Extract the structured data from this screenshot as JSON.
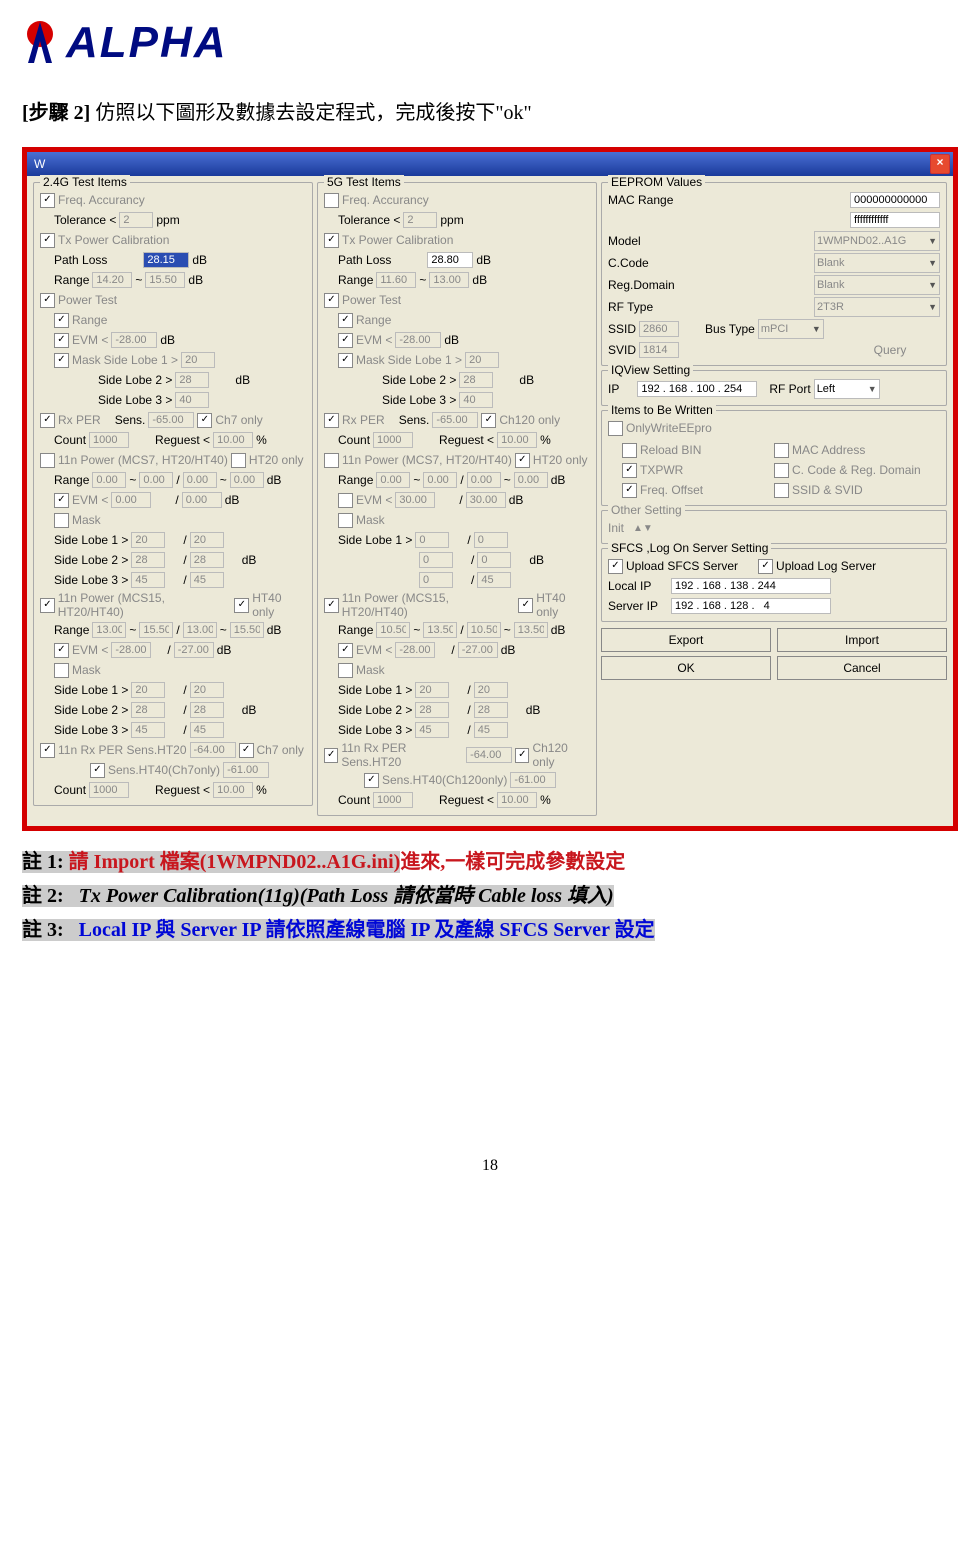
{
  "document": {
    "logo": "ALPHA",
    "step_label": "[步驟 2]",
    "step_text": "仿照以下圖形及數據去設定程式，完成後按下\"ok\"",
    "notes": {
      "n1_label": "註 1:",
      "n1_a": "請 Import 檔案(1WMPND02..A1G.ini)",
      "n1_b": "進來,一樣可完成參數設定",
      "n2_label": "註 2:",
      "n2_text": "Tx Power Calibration(11g)(Path Loss 請依當時 Cable loss 填入)",
      "n3_label": "註 3:",
      "n3_text": "Local IP 與 Server IP 請依照產線電腦 IP 及產線 SFCS Server 設定"
    },
    "page_number": "18"
  },
  "window": {
    "title": "W",
    "groups": {
      "g24": "2.4G Test Items",
      "g5": "5G Test Items",
      "eeprom": "EEPROM Values",
      "iq": "IQView Setting",
      "items": "Items to Be Written",
      "other": "Other Setting",
      "sfcs": "SFCS ,Log On Server Setting"
    },
    "labels": {
      "freq": "Freq. Accurancy",
      "tol": "Tolerance <",
      "ppm": "ppm",
      "txcal": "Tx Power Calibration",
      "path": "Path Loss",
      "range": "Range",
      "db": "dB",
      "ptest": "Power Test",
      "evm": "EVM <",
      "mask": "Mask",
      "sl1": "Side Lobe 1 >",
      "sl2": "Side Lobe 2 >",
      "sl3": "Side Lobe 3 >",
      "rxper": "Rx PER",
      "sens": "Sens.",
      "ch7": "Ch7 only",
      "ch120": "Ch120 only",
      "count": "Count",
      "reguest": "Reguest <",
      "pct": "%",
      "mcs7": "11n Power (MCS7, HT20/HT40)",
      "mcs15": "11n Power (MCS15, HT20/HT40)",
      "ht20": "HT20 only",
      "ht40": "HT40 only",
      "rxper11n": "11n Rx PER  Sens.HT20",
      "sensht40_7": "Sens.HT40(Ch7only)",
      "sensht40_120": "Sens.HT40(Ch120only)",
      "mac": "MAC Range",
      "model": "Model",
      "ccode": "C.Code",
      "reg": "Reg.Domain",
      "rf": "RF Type",
      "ssid": "SSID",
      "svid": "SVID",
      "bus": "Bus Type",
      "query": "Query",
      "ip": "IP",
      "rfport": "RF Port",
      "only": "OnlyWriteEEpro",
      "reload": "Reload BIN",
      "txpwr": "TXPWR",
      "freqoff": "Freq. Offset",
      "macaddr": "MAC Address",
      "ccreg": "C. Code & Reg. Domain",
      "ssidsvid": "SSID & SVID",
      "init": "Init",
      "upsfcs": "Upload SFCS Server",
      "uplog": "Upload Log Server",
      "localip": "Local IP",
      "serverip": "Server IP",
      "export": "Export",
      "import": "Import",
      "ok": "OK",
      "cancel": "Cancel",
      "slash": "/",
      "tilde": "~"
    },
    "values": {
      "tol24": "2",
      "tol5": "2",
      "path24": "28.15",
      "path5": "28.80",
      "range24a": "14.20",
      "range24b": "15.50",
      "range5a": "11.60",
      "range5b": "13.00",
      "evm24": "-28.00",
      "evm5": "-28.00",
      "sl_20": "20",
      "sl_28": "28",
      "sl_40": "40",
      "sl_45": "45",
      "sl_0": "0",
      "sens24": "-65.00",
      "sens5": "-65.00",
      "count": "1000",
      "reg10": "10.00",
      "mcs7_r": "0.00",
      "evm7_30": "30.00",
      "mcs15_a": "13.00",
      "mcs15_b": "15.50",
      "mcs15_5a": "10.50",
      "mcs15_5b": "13.50",
      "evm15a": "-28.00",
      "evm15b": "-27.00",
      "ht20sens": "-64.00",
      "ht40sens": "-61.00",
      "mac1": "000000000000",
      "mac2": "ffffffffffff",
      "model": "1WMPND02..A1G",
      "blank": "Blank",
      "rf": "2T3R",
      "ssid": "2860",
      "svid": "1814",
      "bus": "mPCI",
      "ip": "192 . 168 . 100 . 254",
      "rfport": "Left",
      "localip": "192 . 168 . 138 . 244",
      "serverip": "192 . 168 . 128 .   4"
    }
  }
}
